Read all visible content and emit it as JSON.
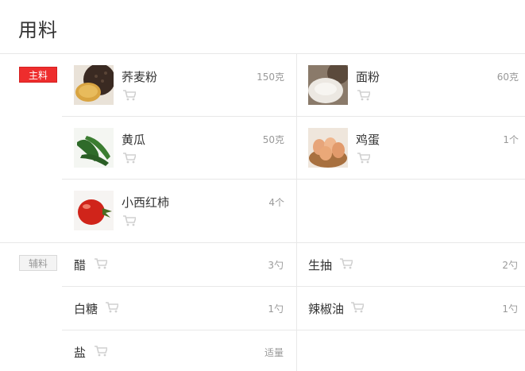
{
  "header": {
    "title": "用料"
  },
  "main_section": {
    "tag": "主料",
    "items": [
      {
        "name": "荞麦粉",
        "amount": "150克",
        "image": "buckwheat-flour"
      },
      {
        "name": "面粉",
        "amount": "60克",
        "image": "flour"
      },
      {
        "name": "黄瓜",
        "amount": "50克",
        "image": "cucumber"
      },
      {
        "name": "鸡蛋",
        "amount": "1个",
        "image": "eggs"
      },
      {
        "name": "小西红柿",
        "amount": "4个",
        "image": "cherry-tomato"
      }
    ]
  },
  "aux_section": {
    "tag": "辅料",
    "items": [
      {
        "name": "醋",
        "amount": "3勺"
      },
      {
        "name": "生抽",
        "amount": "2勺"
      },
      {
        "name": "白糖",
        "amount": "1勺"
      },
      {
        "name": "辣椒油",
        "amount": "1勺"
      },
      {
        "name": "盐",
        "amount": "适量"
      }
    ]
  },
  "colors": {
    "main_tag": "#ee2d2d",
    "cart_icon": "#d0d0d0"
  }
}
